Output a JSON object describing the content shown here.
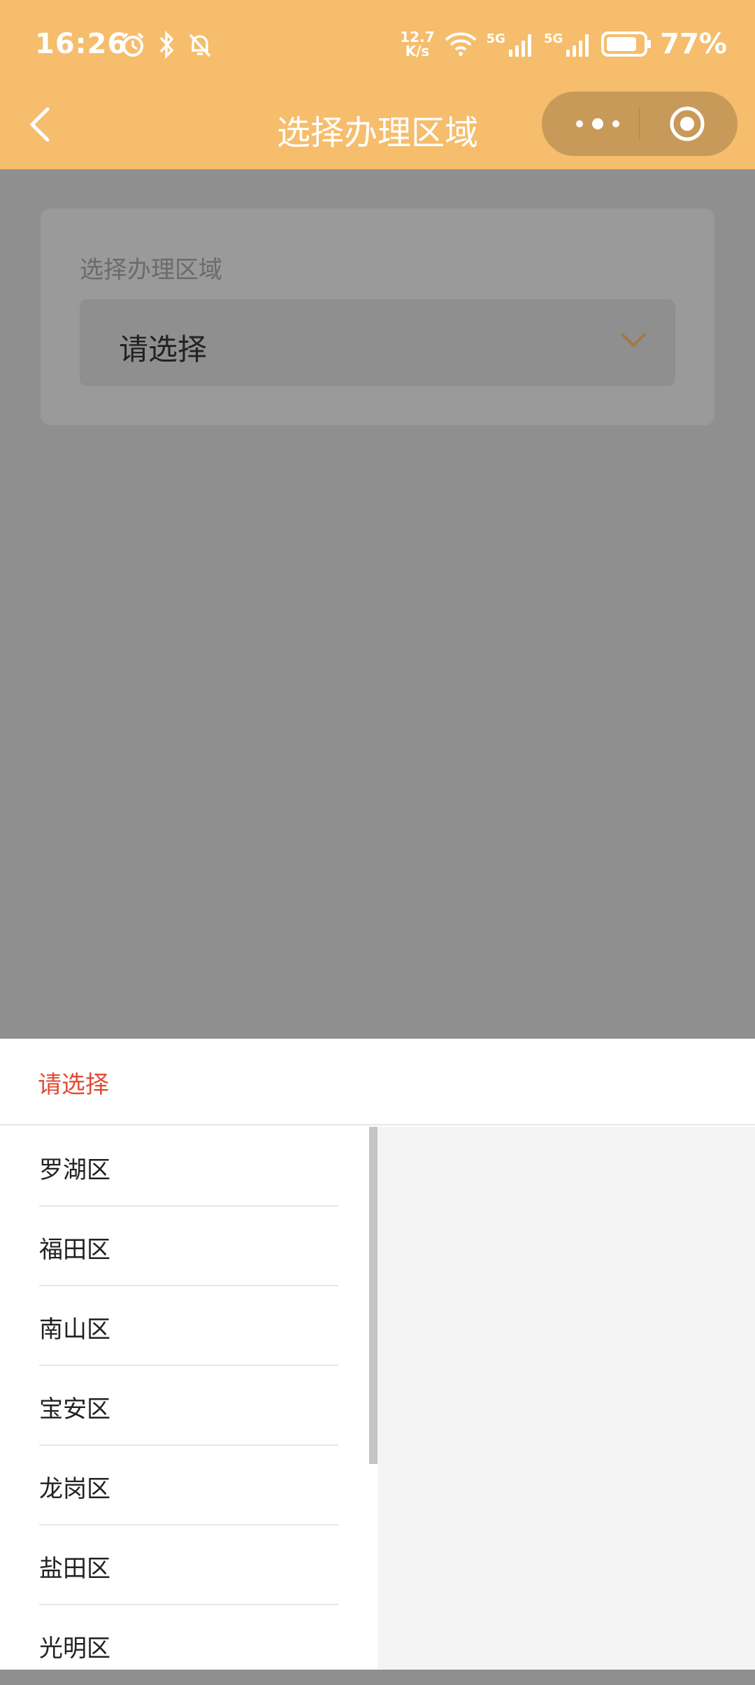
{
  "status_bar": {
    "time": "16:26",
    "net_speed_value": "12.7",
    "net_speed_unit": "K/s",
    "network1": "5G",
    "network2": "5G",
    "battery_percent": "77%"
  },
  "nav": {
    "title": "选择办理区域",
    "back_icon": "chevron-left-icon",
    "more_icon": "more-dots-icon",
    "close_icon": "target-icon"
  },
  "form": {
    "label": "选择办理区域",
    "select_value": "请选择"
  },
  "picker": {
    "header": "请选择",
    "items": [
      "罗湖区",
      "福田区",
      "南山区",
      "宝安区",
      "龙岗区",
      "盐田区",
      "光明区"
    ]
  },
  "colors": {
    "topbar": "#f5bd6c",
    "accent_red": "#e24b34",
    "overlay": "#8f8f8f"
  }
}
